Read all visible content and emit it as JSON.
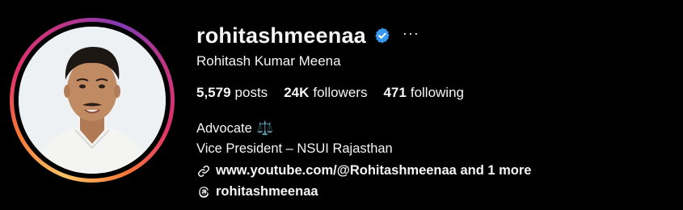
{
  "profile": {
    "username": "rohitashmeenaa",
    "full_name": "Rohitash Kumar Meena",
    "verified_icon": "verified-badge-icon",
    "more_label": "···",
    "accent_color": "#3897f0"
  },
  "stats": {
    "posts_count": "5,579",
    "posts_label": "posts",
    "followers_count": "24K",
    "followers_label": "followers",
    "following_count": "471",
    "following_label": "following"
  },
  "bio": {
    "line1": "Advocate",
    "line1_emoji": "⚖️",
    "line2": "Vice President – NSUI Rajasthan"
  },
  "links": {
    "website": "www.youtube.com/@Rohitashmeenaa and 1 more",
    "threads": "rohitashmeenaa"
  }
}
